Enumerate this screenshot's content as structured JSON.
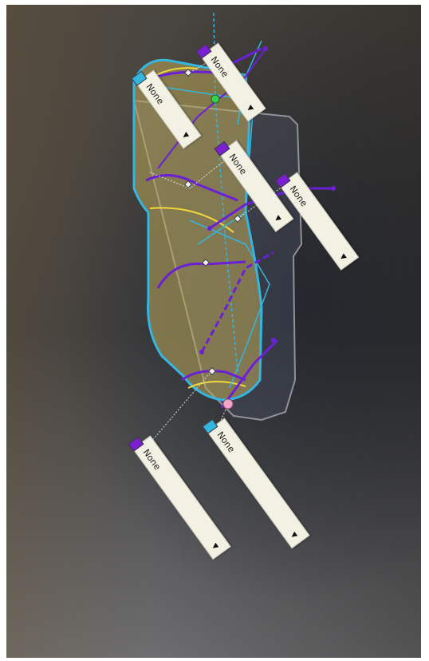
{
  "dropdowns": [
    {
      "value": "None",
      "chip_color": "#7a1fd1",
      "arrow": "▼"
    },
    {
      "value": "None",
      "chip_color": "#35b6e0",
      "arrow": "▼"
    },
    {
      "value": "None",
      "chip_color": "#7a1fd1",
      "arrow": "▼"
    },
    {
      "value": "None",
      "chip_color": "#7a1fd1",
      "arrow": "▼"
    },
    {
      "value": "None",
      "chip_color": "#7a1fd1",
      "arrow": "▼"
    },
    {
      "value": "None",
      "chip_color": "#35b6e0",
      "arrow": "▼"
    }
  ],
  "colors": {
    "surface_fill": "#8a7a3a",
    "outline_cyan": "#35b6e0",
    "curve_purple": "#6b1fd6",
    "curve_yellow": "#f2d83a",
    "outline_grey": "#8f9299"
  }
}
